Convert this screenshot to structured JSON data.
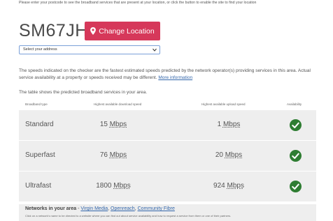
{
  "intro": "Please enter your postcode to see the broadband services that are present at your location, or click the button to enable the site to find your location",
  "postcode": "SM67JH",
  "change_button": "Change Location",
  "address_select": "Select your address",
  "speeds_text": "The speeds indicated on the checker are the fastest estimated speeds predicted by the network operator(s) providing services in this area. Actual service availability at a property or speeds received may be different.",
  "more_info_link": "More information",
  "table_intro": "The table shows the predicted broadband services in your area.",
  "columns": {
    "type": "Broadband type",
    "download": "Highest available download speed",
    "upload": "Highest available upload speed",
    "availability": "Availability"
  },
  "rows": [
    {
      "type": "Standard",
      "download": "15",
      "upload": "1",
      "unit": "Mbps",
      "available": true
    },
    {
      "type": "Superfast",
      "download": "76",
      "upload": "20",
      "unit": "Mbps",
      "available": true
    },
    {
      "type": "Ultrafast",
      "download": "1800",
      "upload": "924",
      "unit": "Mbps",
      "available": true
    }
  ],
  "networks": {
    "title": "Networks in your area",
    "separator": " - ",
    "links": [
      "Virgin Media",
      "Openreach",
      "Community Fibre"
    ],
    "note": "Click on a network's name to be directed to a website where you can find out about service availability and how to request a service from them or one of their partners."
  },
  "colors": {
    "accent": "#d6385a",
    "check": "#2e7d32",
    "row_bg": "#eeeeee",
    "link": "#3366aa"
  }
}
